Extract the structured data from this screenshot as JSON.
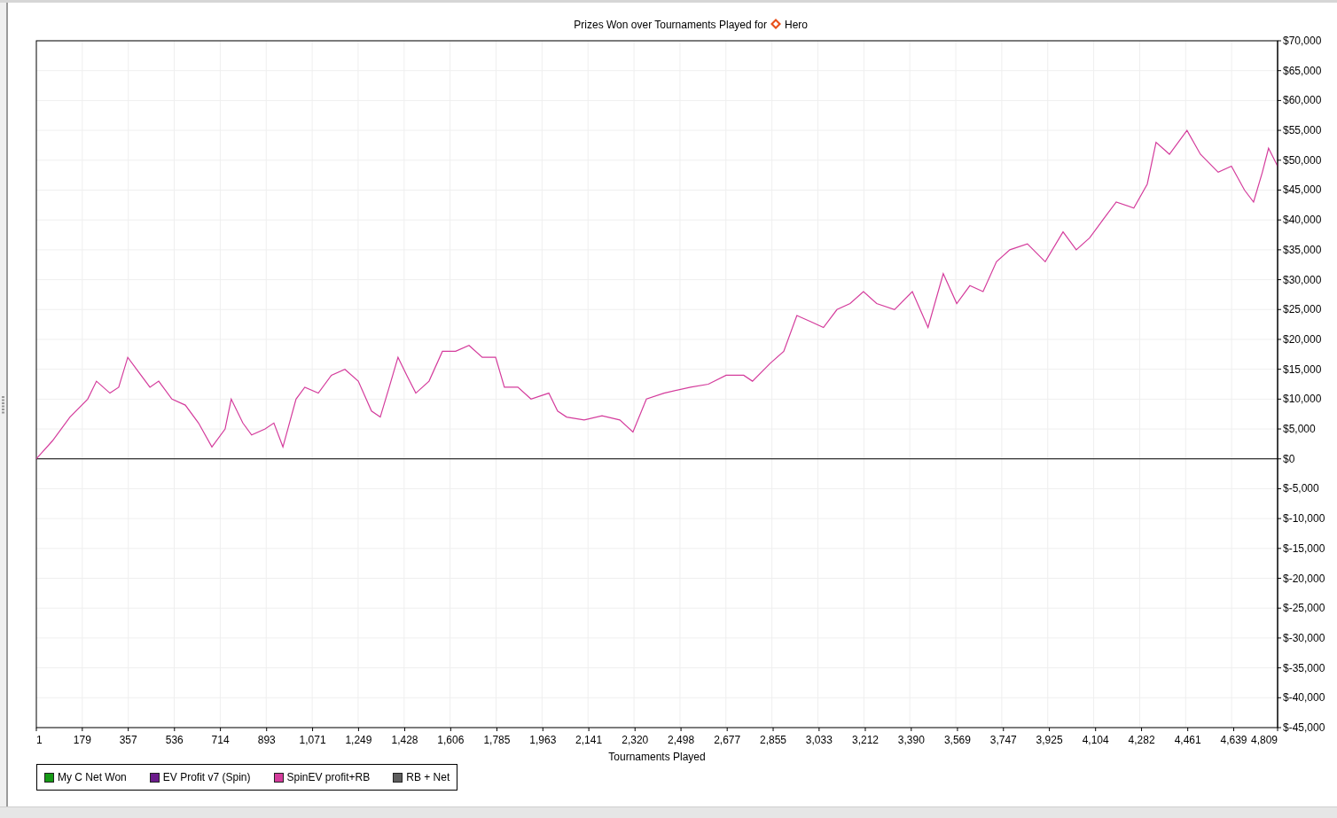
{
  "chart": {
    "title": "Prizes Won over Tournaments Played for",
    "player": "Hero",
    "legend": [
      {
        "label": "My C Net Won",
        "color": "#169a16"
      },
      {
        "label": "EV Profit v7 (Spin)",
        "color": "#6b1b8b"
      },
      {
        "kind": "series",
        "color": "#d43c9c"
      },
      {
        "label": "RB + Net",
        "color": "#5e5e5e"
      }
    ],
    "chart_data": {
      "type": "line",
      "grid": true,
      "xlabel": "Tournaments Played",
      "x": [
        1,
        63,
        131,
        200,
        234,
        286,
        320,
        355,
        389,
        441,
        475,
        526,
        578,
        629,
        681,
        732,
        756,
        801,
        835,
        887,
        921,
        956,
        1007,
        1041,
        1093,
        1144,
        1196,
        1248,
        1299,
        1333,
        1368,
        1402,
        1436,
        1471,
        1522,
        1574,
        1625,
        1677,
        1728,
        1780,
        1814,
        1866,
        1917,
        1986,
        2020,
        2055,
        2123,
        2192,
        2261,
        2312,
        2364,
        2432,
        2535,
        2604,
        2673,
        2741,
        2775,
        2844,
        2896,
        2947,
        2999,
        3050,
        3102,
        3153,
        3205,
        3256,
        3325,
        3394,
        3455,
        3514,
        3566,
        3617,
        3668,
        3720,
        3772,
        3840,
        3909,
        3978,
        4029,
        4081,
        4132,
        4184,
        4252,
        4304,
        4338,
        4390,
        4458,
        4510,
        4579,
        4630,
        4681,
        4716,
        4750,
        4774,
        4809
      ],
      "series": [
        {
          "name": "SpinEV profit+RB",
          "color": "#d43c9c",
          "values": [
            0,
            3000,
            7000,
            10000,
            13000,
            11000,
            12000,
            17000,
            15000,
            12000,
            13000,
            10000,
            9000,
            6000,
            2000,
            5000,
            10000,
            6000,
            4000,
            5000,
            6000,
            2000,
            10000,
            12000,
            11000,
            14000,
            15000,
            13000,
            8000,
            7000,
            12000,
            17000,
            14000,
            11000,
            13000,
            18000,
            18000,
            19000,
            17000,
            17000,
            12000,
            12000,
            10000,
            11000,
            8000,
            7000,
            6500,
            7200,
            6500,
            4500,
            10000,
            11000,
            12000,
            12500,
            14000,
            14000,
            13000,
            16000,
            18000,
            24000,
            23000,
            22000,
            25000,
            26000,
            28000,
            26000,
            25000,
            28000,
            22000,
            31000,
            26000,
            29000,
            28000,
            33000,
            35000,
            36000,
            33000,
            38000,
            35000,
            37000,
            40000,
            43000,
            42000,
            46000,
            53000,
            51000,
            55000,
            51000,
            48000,
            49000,
            45000,
            43000,
            48000,
            52000,
            49000
          ]
        }
      ],
      "xlim": [
        1,
        4809
      ],
      "ylim": [
        -45000,
        70000
      ],
      "xticks": [
        {
          "value": 1,
          "label": "1"
        },
        {
          "value": 179,
          "label": "179"
        },
        {
          "value": 357,
          "label": "357"
        },
        {
          "value": 536,
          "label": "536"
        },
        {
          "value": 714,
          "label": "714"
        },
        {
          "value": 893,
          "label": "893"
        },
        {
          "value": 1071,
          "label": "1,071"
        },
        {
          "value": 1249,
          "label": "1,249"
        },
        {
          "value": 1428,
          "label": "1,428"
        },
        {
          "value": 1606,
          "label": "1,606"
        },
        {
          "value": 1785,
          "label": "1,785"
        },
        {
          "value": 1963,
          "label": "1,963"
        },
        {
          "value": 2141,
          "label": "2,141"
        },
        {
          "value": 2320,
          "label": "2,320"
        },
        {
          "value": 2498,
          "label": "2,498"
        },
        {
          "value": 2677,
          "label": "2,677"
        },
        {
          "value": 2855,
          "label": "2,855"
        },
        {
          "value": 3033,
          "label": "3,033"
        },
        {
          "value": 3212,
          "label": "3,212"
        },
        {
          "value": 3390,
          "label": "3,390"
        },
        {
          "value": 3569,
          "label": "3,569"
        },
        {
          "value": 3747,
          "label": "3,747"
        },
        {
          "value": 3925,
          "label": "3,925"
        },
        {
          "value": 4104,
          "label": "4,104"
        },
        {
          "value": 4282,
          "label": "4,282"
        },
        {
          "value": 4461,
          "label": "4,461"
        },
        {
          "value": 4639,
          "label": "4,639"
        },
        {
          "value": 4809,
          "label": "4,809"
        }
      ],
      "yticks": [
        {
          "value": 70000,
          "label": "$70,000"
        },
        {
          "value": 65000,
          "label": "$65,000"
        },
        {
          "value": 60000,
          "label": "$60,000"
        },
        {
          "value": 55000,
          "label": "$55,000"
        },
        {
          "value": 50000,
          "label": "$50,000"
        },
        {
          "value": 45000,
          "label": "$45,000"
        },
        {
          "value": 40000,
          "label": "$40,000"
        },
        {
          "value": 35000,
          "label": "$35,000"
        },
        {
          "value": 30000,
          "label": "$30,000"
        },
        {
          "value": 25000,
          "label": "$25,000"
        },
        {
          "value": 20000,
          "label": "$20,000"
        },
        {
          "value": 15000,
          "label": "$15,000"
        },
        {
          "value": 10000,
          "label": "$10,000"
        },
        {
          "value": 5000,
          "label": "$5,000"
        },
        {
          "value": 0,
          "label": "$0"
        },
        {
          "value": -5000,
          "label": "$-5,000"
        },
        {
          "value": -10000,
          "label": "$-10,000"
        },
        {
          "value": -15000,
          "label": "$-15,000"
        },
        {
          "value": -20000,
          "label": "$-20,000"
        },
        {
          "value": -25000,
          "label": "$-25,000"
        },
        {
          "value": -30000,
          "label": "$-30,000"
        },
        {
          "value": -35000,
          "label": "$-35,000"
        },
        {
          "value": -40000,
          "label": "$-40,000"
        },
        {
          "value": -45000,
          "label": "$-45,000"
        }
      ]
    }
  }
}
